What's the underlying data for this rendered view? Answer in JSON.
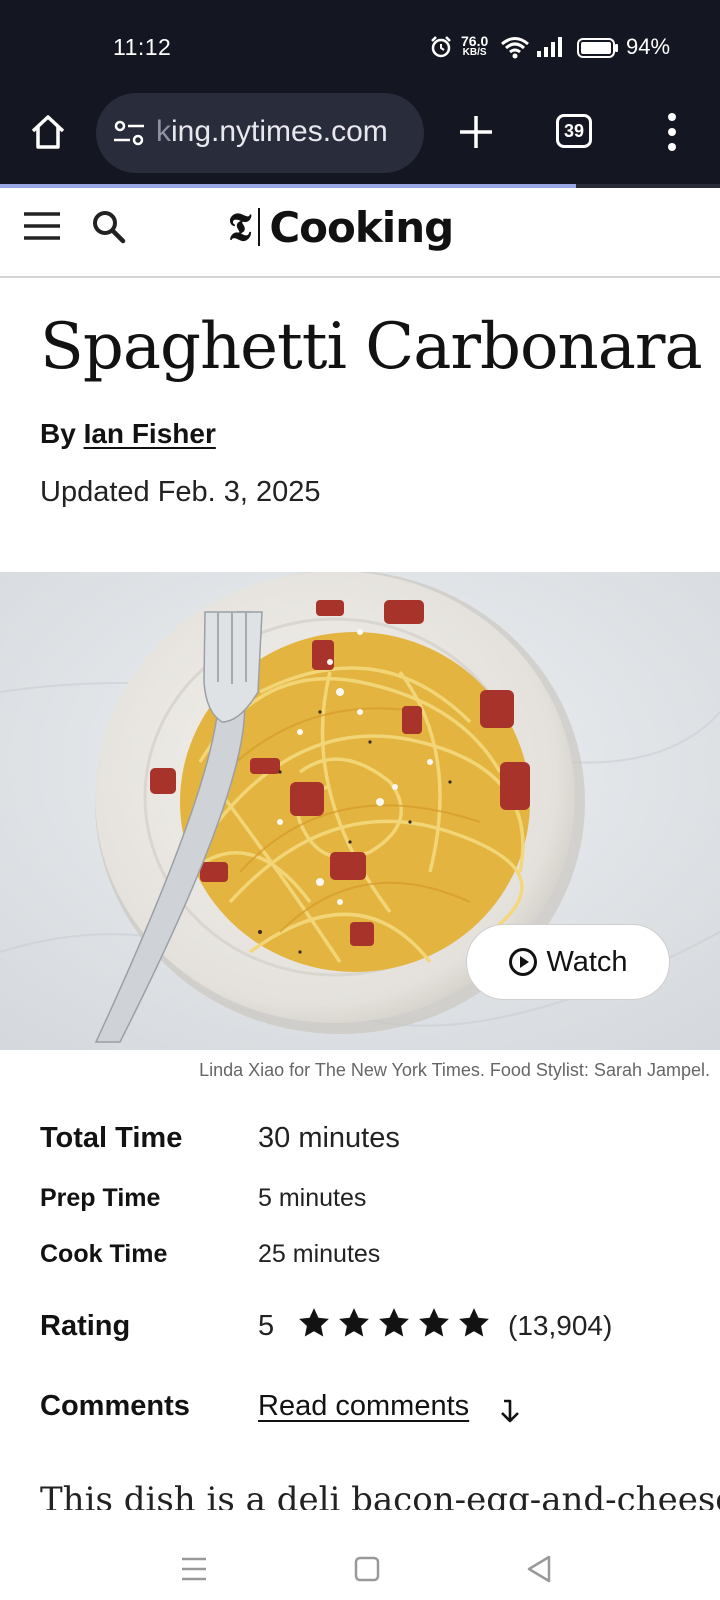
{
  "status_bar": {
    "time": "11:12",
    "net_speed_value": "76.0",
    "net_speed_unit": "KB/S",
    "battery": "94%"
  },
  "browser": {
    "url_prefix": "k",
    "url_rest": "ing.nytimes.com",
    "tab_count": "39",
    "page_load_progress": 0.8
  },
  "site": {
    "brand": "Cooking"
  },
  "recipe": {
    "title": "Spaghetti Carbonara",
    "by_prefix": "By",
    "author": "Ian Fisher",
    "updated": "Updated Feb. 3, 2025",
    "watch_label": "Watch",
    "caption": "Linda Xiao for The New York Times. Food Stylist: Sarah Jampel.",
    "meta": {
      "total_time_label": "Total Time",
      "total_time": "30 minutes",
      "prep_time_label": "Prep Time",
      "prep_time": "5 minutes",
      "cook_time_label": "Cook Time",
      "cook_time": "25 minutes",
      "rating_label": "Rating",
      "rating": "5",
      "rating_stars": 5,
      "rating_count": "(13,904)",
      "comments_label": "Comments",
      "comments_link": "Read comments"
    },
    "intro_teaser": "This dish is a deli bacon-egg-and-cheese-"
  },
  "icons": [
    "alarm-icon",
    "wifi-icon",
    "signal-icon",
    "battery-icon",
    "home-icon",
    "site-settings-icon",
    "plus-icon",
    "tabs-icon",
    "overflow-menu-icon",
    "hamburger-icon",
    "search-icon",
    "nyt-logo-icon",
    "play-icon",
    "star-icon",
    "arrow-down-icon",
    "nav-menu-icon",
    "nav-home-icon",
    "nav-back-icon"
  ],
  "colors": {
    "chrome_bg": "#141621",
    "omnibox_bg": "#292c3a",
    "progress": "#9aa6e6",
    "text": "#121212"
  }
}
